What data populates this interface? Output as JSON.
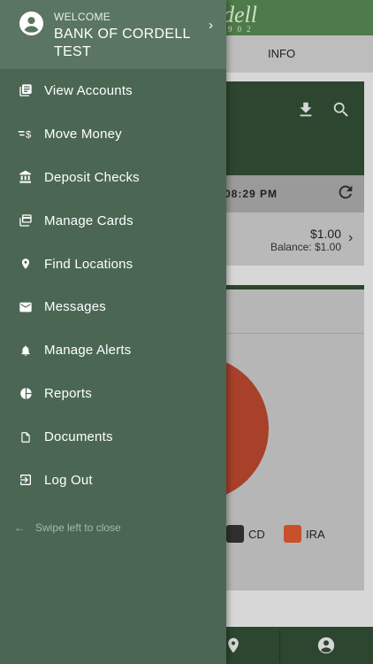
{
  "background": {
    "logo_text": "dell",
    "logo_year": "902",
    "tab_info": "INFO",
    "time_text": "08:29 PM",
    "account_amount": "$1.00",
    "account_balance": "Balance: $1.00",
    "legend": [
      {
        "label": "CD",
        "color": "#2f2f2f"
      },
      {
        "label": "IRA",
        "color": "#c8502a"
      }
    ],
    "pie_color": "#a8402a"
  },
  "drawer": {
    "welcome_label": "WELCOME",
    "bank_name": "BANK OF CORDELL TEST",
    "menu": [
      {
        "label": "View Accounts",
        "icon": "accounts-icon"
      },
      {
        "label": "Move Money",
        "icon": "move-money-icon"
      },
      {
        "label": "Deposit Checks",
        "icon": "bank-icon"
      },
      {
        "label": "Manage Cards",
        "icon": "card-icon"
      },
      {
        "label": "Find Locations",
        "icon": "location-pin-icon"
      },
      {
        "label": "Messages",
        "icon": "mail-icon"
      },
      {
        "label": "Manage Alerts",
        "icon": "bell-icon"
      },
      {
        "label": "Reports",
        "icon": "pie-chart-icon"
      },
      {
        "label": "Documents",
        "icon": "document-icon"
      },
      {
        "label": "Log Out",
        "icon": "logout-icon"
      }
    ],
    "swipe_hint": "Swipe left to close"
  },
  "colors": {
    "drawer_bg": "#4b6754",
    "drawer_header_bg": "#5a7663",
    "brand_dark": "#2c4630"
  }
}
